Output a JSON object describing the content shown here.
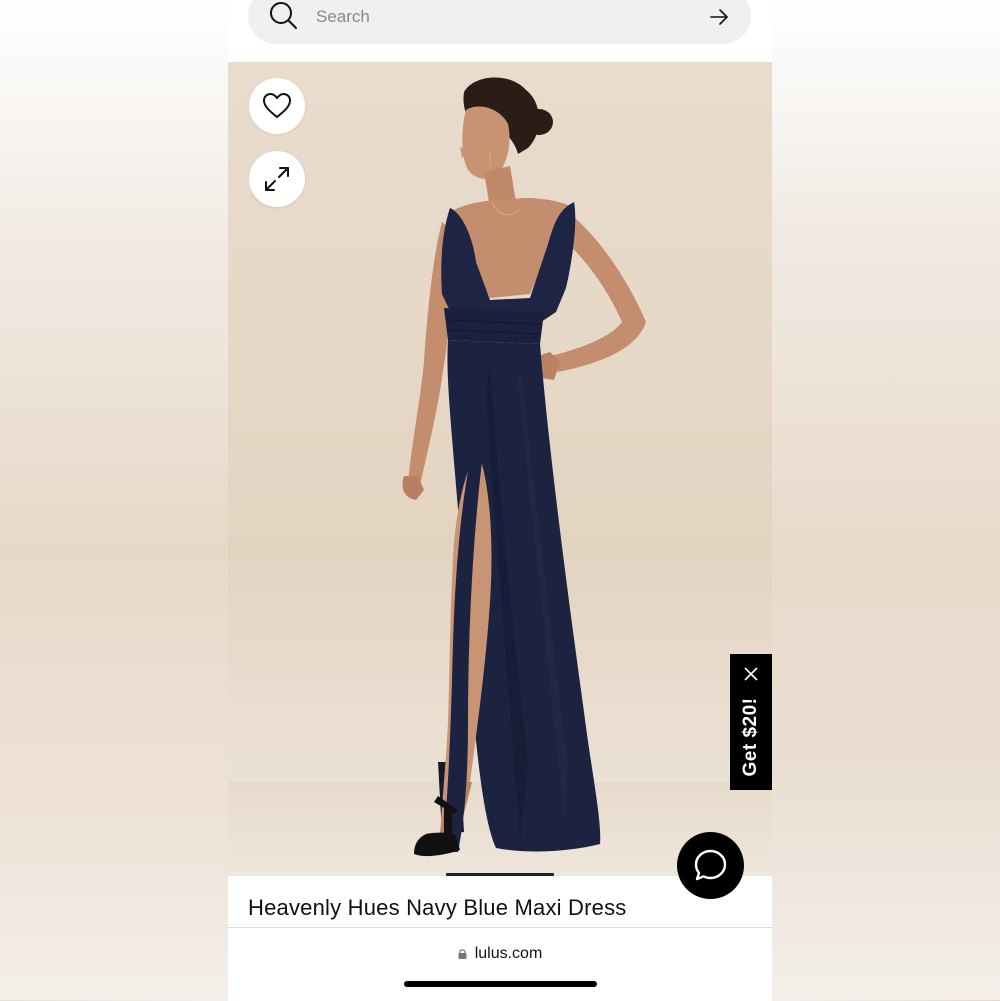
{
  "search": {
    "placeholder": "Search"
  },
  "product": {
    "title": "Heavenly Hues Navy Blue Maxi Dress",
    "image_alt": "Model wearing navy blue maxi dress with deep V neckline and side slit",
    "dress_color": "#1b2340"
  },
  "actions": {
    "wishlist_icon": "heart-icon",
    "zoom_icon": "expand-icon"
  },
  "promo": {
    "label": "Get $20!"
  },
  "browser": {
    "url": "lulus.com"
  },
  "colors": {
    "accent": "#000000",
    "image_background": "#e6d7c6"
  }
}
